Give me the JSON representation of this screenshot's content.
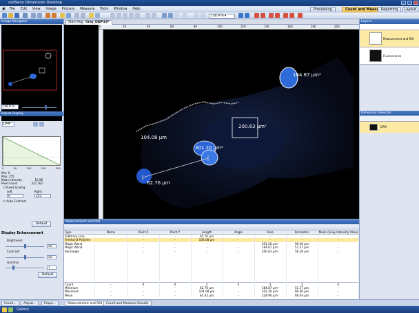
{
  "app": {
    "title": "cellSens Dimension Desktop"
  },
  "menu": [
    "File",
    "Edit",
    "View",
    "Image",
    "Process",
    "Measure",
    "Tools",
    "Window",
    "Help"
  ],
  "toolbar": {
    "zoom": "130.9 %"
  },
  "workspaces": [
    {
      "label": "Processing"
    },
    {
      "label": "Count and Measure"
    },
    {
      "label": "Reporting"
    },
    {
      "label": "Layout"
    }
  ],
  "left": {
    "nav_title": "Image Navigator",
    "nav_zoom": "130.9 %",
    "adjust_title": "Adjust Display",
    "histogram_label": "Histogram",
    "channel": "DAPI",
    "hist_ticks": [
      "0",
      "50",
      "100",
      "150",
      "200"
    ],
    "stats": [
      {
        "label": "Min:",
        "value": "0"
      },
      {
        "label": "Max:",
        "value": "255"
      },
      {
        "label": "Mean Intensity:",
        "value": "15.98"
      },
      {
        "label": "Pixel Count:",
        "value": "327,162"
      }
    ],
    "fixed_scaling": "Fixed Scaling",
    "left_label": "Left:",
    "right_label": "Right:",
    "left_value": "0",
    "right_value": "255",
    "auto_contrast": "Auto Contrast",
    "default_btn": "Default",
    "display_title": "Display Enhancement",
    "brightness_label": "Brightness:",
    "brightness_value": "50",
    "contrast_label": "Contrast:",
    "contrast_value": "50",
    "gamma_label": "Gamma:",
    "gamma_value": "1",
    "default_btn2": "Default"
  },
  "doc_tabs": [
    {
      "label": "Start Page"
    },
    {
      "label": "Gray_DAPI10*"
    }
  ],
  "ruler_ticks": [
    "0",
    "20",
    "40",
    "60",
    "80",
    "100",
    "120",
    "140",
    "160",
    "180",
    "200"
  ],
  "measurements_overlay": [
    {
      "text": "184.87 µm²"
    },
    {
      "text": "200.63 µm²"
    },
    {
      "text": "104.08 µm"
    },
    {
      "text": "301.20 µm²"
    },
    {
      "text": "62.76 µm"
    }
  ],
  "right": {
    "layers_title": "Layers",
    "layers": [
      {
        "label": "Measurement and ROI"
      },
      {
        "label": "Fluorescence"
      }
    ],
    "dim_title": "Dimension Selector",
    "channel": "DAPI"
  },
  "measure_panel": {
    "title": "Measurement and ROI",
    "columns": [
      "Type",
      "Name",
      "Point X",
      "Point Y",
      "Length",
      "Angle",
      "Area",
      "Perimeter",
      "Mean (Gray Intensity Value)"
    ],
    "rows": [
      {
        "type": "Arbitrary Line",
        "name": "",
        "px": "-",
        "py": "-",
        "length": "62.76 µm",
        "angle": "-",
        "area": "-",
        "perim": "-",
        "mean": "-"
      },
      {
        "type": "Freehand Polyline",
        "name": "",
        "px": "-",
        "py": "-",
        "length": "104.08 µm",
        "angle": "-",
        "area": "-",
        "perim": "-",
        "mean": "-"
      },
      {
        "type": "Magic Wand",
        "name": "",
        "px": "-",
        "py": "-",
        "length": "-",
        "angle": "-",
        "area": "301.20 µm²",
        "perim": "90.46 µm",
        "mean": "-"
      },
      {
        "type": "Magic Wand",
        "name": "",
        "px": "-",
        "py": "-",
        "length": "-",
        "angle": "-",
        "area": "184.87 µm²",
        "perim": "51.37 µm",
        "mean": "-"
      },
      {
        "type": "Rectangle",
        "name": "",
        "px": "-",
        "py": "-",
        "length": "-",
        "angle": "-",
        "area": "200.63 µm²",
        "perim": "56.28 µm",
        "mean": "-"
      }
    ],
    "stats": [
      {
        "type": "Count",
        "name": "-",
        "px": "0",
        "py": "0",
        "length": "2",
        "angle": "0",
        "area": "3",
        "perim": "3",
        "mean": "0"
      },
      {
        "type": "Minimum",
        "name": "-",
        "px": "-",
        "py": "-",
        "length": "62.76 µm",
        "angle": "-",
        "area": "184.87 µm²",
        "perim": "51.37 µm",
        "mean": "-"
      },
      {
        "type": "Maximum",
        "name": "-",
        "px": "-",
        "py": "-",
        "length": "104.08 µm",
        "angle": "-",
        "area": "301.20 µm²",
        "perim": "90.46 µm",
        "mean": "-"
      },
      {
        "type": "Mean",
        "name": "-",
        "px": "-",
        "py": "-",
        "length": "83.42 µm",
        "angle": "-",
        "area": "228.90 µm²",
        "perim": "66.04 µm",
        "mean": "-"
      }
    ]
  },
  "bottom_tabs": [
    {
      "label": "Count..."
    },
    {
      "label": "Adjust..."
    },
    {
      "label": "Prope..."
    },
    {
      "label": "Measurement and ROI"
    },
    {
      "label": "Count and Measure Results"
    }
  ],
  "taskbar": {
    "gallery": "Gallery"
  }
}
